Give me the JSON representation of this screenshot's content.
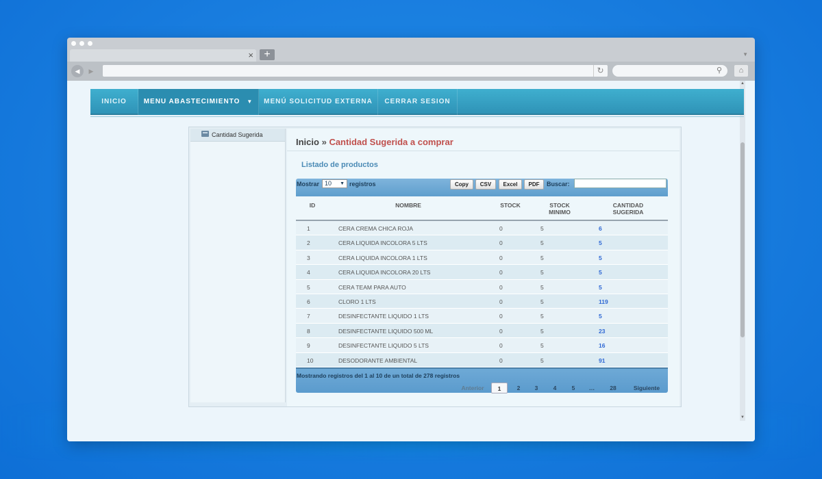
{
  "browser": {
    "tab_close": "×",
    "tab_new": "+",
    "back": "◀",
    "forward": "▶",
    "reload": "↻",
    "search_icon": "⚲",
    "home": "⌂"
  },
  "nav": {
    "items": [
      "INICIO",
      "MENU ABASTECIMIENTO",
      "MENÚ SOLICITUD EXTERNA",
      "CERRAR SESION"
    ],
    "dropdown_caret": "▼"
  },
  "sidebar": {
    "items": [
      {
        "label": "Cantidad Sugerida",
        "icon": "box-icon"
      }
    ]
  },
  "breadcrumb": {
    "home": "Inicio",
    "separator": "»",
    "current": "Cantidad Sugerida a comprar"
  },
  "section_title": "Listado de productos",
  "table_controls": {
    "show_label": "Mostrar",
    "show_value": "10",
    "registros_label": "registros",
    "buttons": [
      "Copy",
      "CSV",
      "Excel",
      "PDF"
    ],
    "search_label": "Buscar:"
  },
  "table": {
    "headers": [
      "ID",
      "NOMBRE",
      "STOCK",
      "STOCK MINIMO",
      "CANTIDAD SUGERIDA"
    ],
    "rows": [
      [
        "1",
        "CERA CREMA CHICA ROJA",
        "0",
        "5",
        "6"
      ],
      [
        "2",
        "CERA LIQUIDA INCOLORA 5 LTS",
        "0",
        "5",
        "5"
      ],
      [
        "3",
        "CERA LIQUIDA INCOLORA 1 LTS",
        "0",
        "5",
        "5"
      ],
      [
        "4",
        "CERA LIQUIDA INCOLORA 20 LTS",
        "0",
        "5",
        "5"
      ],
      [
        "5",
        "CERA TEAM PARA AUTO",
        "0",
        "5",
        "5"
      ],
      [
        "6",
        "CLORO 1 LTS",
        "0",
        "5",
        "119"
      ],
      [
        "7",
        "DESINFECTANTE LIQUIDO 1 LTS",
        "0",
        "5",
        "5"
      ],
      [
        "8",
        "DESINFECTANTE LIQUIDO 500 ML",
        "0",
        "5",
        "23"
      ],
      [
        "9",
        "DESINFECTANTE LIQUIDO 5 LTS",
        "0",
        "5",
        "16"
      ],
      [
        "10",
        "DESODORANTE AMBIENTAL",
        "0",
        "5",
        "91"
      ]
    ]
  },
  "footer": {
    "info": "Mostrando registros del 1 al 10 de un total de 278 registros",
    "pagination": [
      "Anterior",
      "1",
      "2",
      "3",
      "4",
      "5",
      "…",
      "28",
      "Siguiente"
    ],
    "current_page": "1"
  },
  "colors": {
    "background": "#1a7fe0",
    "navbar": "#3fafcf",
    "breadcrumb_current": "#c0504d",
    "quantity_link": "#2f68d4"
  }
}
